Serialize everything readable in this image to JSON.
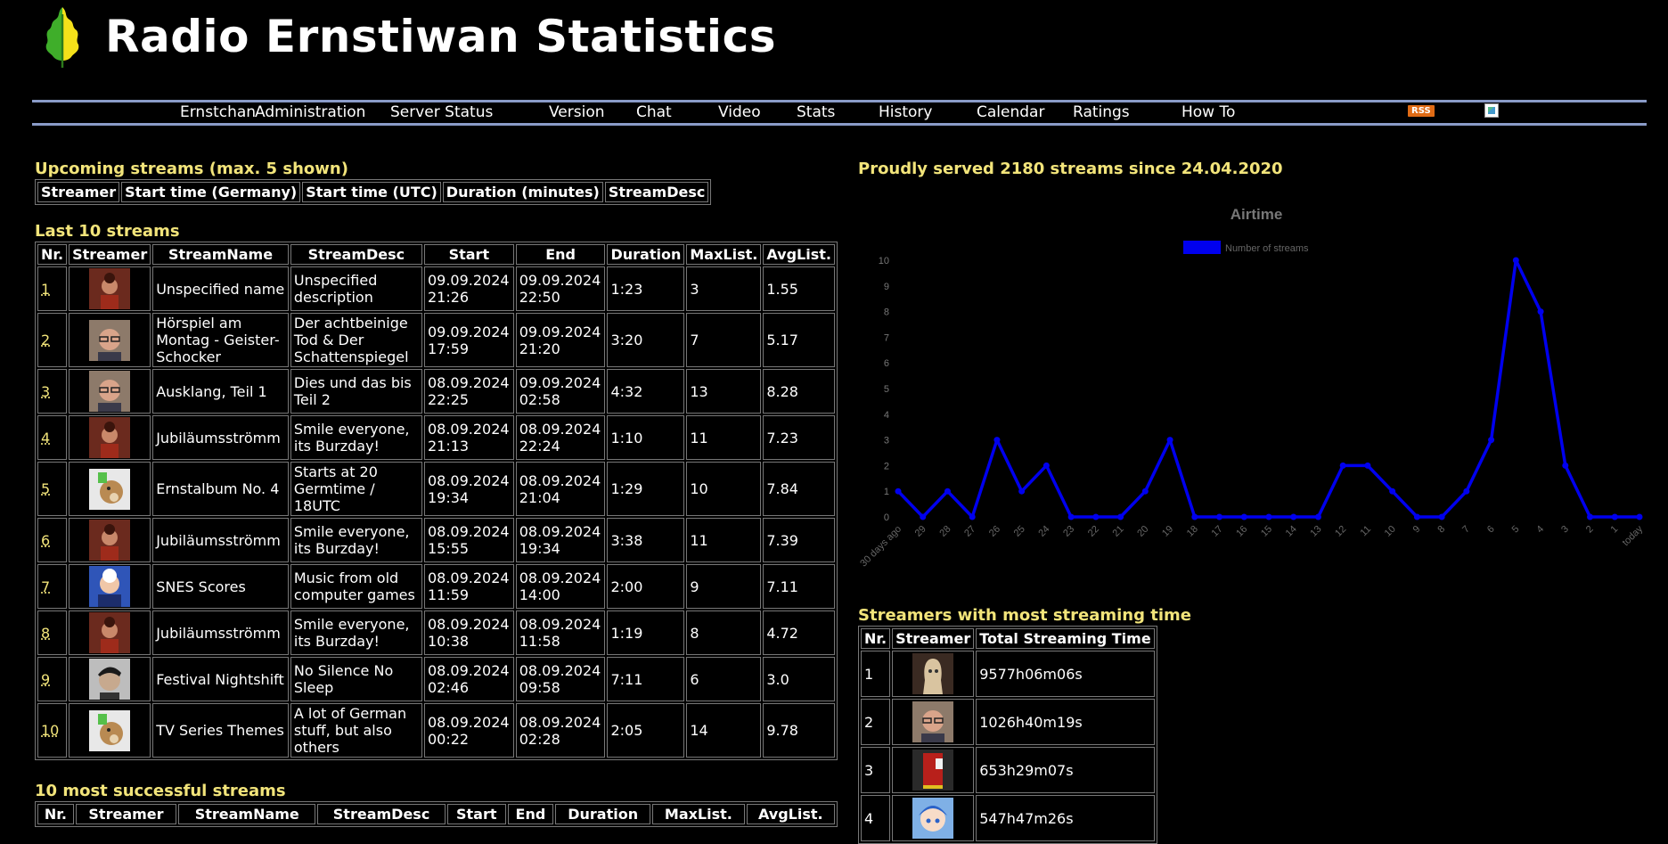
{
  "site": {
    "title": "Radio Ernstiwan Statistics"
  },
  "nav": {
    "items": [
      "Ernstchan",
      "Administration",
      "Server Status",
      "Version",
      "Chat",
      "Video",
      "Stats",
      "History",
      "Calendar",
      "Ratings",
      "How To"
    ],
    "rss_label": "RSS"
  },
  "upcoming": {
    "title": "Upcoming streams (max. 5 shown)",
    "headers": [
      "Streamer",
      "Start time (Germany)",
      "Start time (UTC)",
      "Duration (minutes)",
      "StreamDesc"
    ]
  },
  "last10": {
    "title": "Last 10 streams",
    "headers": [
      "Nr.",
      "Streamer",
      "StreamName",
      "StreamDesc",
      "Start",
      "End",
      "Duration",
      "MaxList.",
      "AvgList."
    ],
    "rows": [
      {
        "nr": "1",
        "avatar": "red-figure",
        "name": "Unspecified name",
        "desc": "Unspecified description",
        "start": "09.09.2024 21:26",
        "end": "09.09.2024 22:50",
        "duration": "1:23",
        "max": "3",
        "avg": "1.55"
      },
      {
        "nr": "2",
        "avatar": "glasses-man",
        "name": "Hörspiel am Montag - Geister-Schocker",
        "desc": "Der achtbeinige Tod & Der Schattenspiegel",
        "start": "09.09.2024 17:59",
        "end": "09.09.2024 21:20",
        "duration": "3:20",
        "max": "7",
        "avg": "5.17"
      },
      {
        "nr": "3",
        "avatar": "glasses-man",
        "name": "Ausklang, Teil 1",
        "desc": "Dies und das bis Teil 2",
        "start": "08.09.2024 22:25",
        "end": "09.09.2024 02:58",
        "duration": "4:32",
        "max": "13",
        "avg": "8.28"
      },
      {
        "nr": "4",
        "avatar": "red-figure",
        "name": "Jubiläumsströmm",
        "desc": "Smile everyone, its Burzday!",
        "start": "08.09.2024 21:13",
        "end": "08.09.2024 22:24",
        "duration": "1:10",
        "max": "11",
        "avg": "7.23"
      },
      {
        "nr": "5",
        "avatar": "bear",
        "name": "Ernstalbum No. 4",
        "desc": "Starts at 20 Germtime / 18UTC",
        "start": "08.09.2024 19:34",
        "end": "08.09.2024 21:04",
        "duration": "1:29",
        "max": "10",
        "avg": "7.84"
      },
      {
        "nr": "6",
        "avatar": "red-figure",
        "name": "Jubiläumsströmm",
        "desc": "Smile everyone, its Burzday!",
        "start": "08.09.2024 15:55",
        "end": "08.09.2024 19:34",
        "duration": "3:38",
        "max": "11",
        "avg": "7.39"
      },
      {
        "nr": "7",
        "avatar": "old-man",
        "name": "SNES Scores",
        "desc": "Music from old computer games",
        "start": "08.09.2024 11:59",
        "end": "08.09.2024 14:00",
        "duration": "2:00",
        "max": "9",
        "avg": "7.11"
      },
      {
        "nr": "8",
        "avatar": "red-figure",
        "name": "Jubiläumsströmm",
        "desc": "Smile everyone, its Burzday!",
        "start": "08.09.2024 10:38",
        "end": "08.09.2024 11:58",
        "duration": "1:19",
        "max": "8",
        "avg": "4.72"
      },
      {
        "nr": "9",
        "avatar": "elvis",
        "name": "Festival Nightshift",
        "desc": "No Silence No Sleep",
        "start": "08.09.2024 02:46",
        "end": "08.09.2024 09:58",
        "duration": "7:11",
        "max": "6",
        "avg": "3.0"
      },
      {
        "nr": "10",
        "avatar": "bear",
        "name": "TV Series Themes",
        "desc": "A lot of German stuff, but also others",
        "start": "08.09.2024 00:22",
        "end": "08.09.2024 02:28",
        "duration": "2:05",
        "max": "14",
        "avg": "9.78"
      }
    ]
  },
  "successful": {
    "title": "10 most successful streams",
    "headers": [
      "Nr.",
      "Streamer",
      "StreamName",
      "StreamDesc",
      "Start",
      "End",
      "Duration",
      "MaxList.",
      "AvgList."
    ]
  },
  "served": {
    "text": "Proudly served 2180 streams since 24.04.2020"
  },
  "top_streamers": {
    "title": "Streamers with most streaming time",
    "headers": [
      "Nr.",
      "Streamer",
      "Total Streaming Time"
    ],
    "rows": [
      {
        "nr": "1",
        "avatar": "ghost",
        "time": "9577h06m06s"
      },
      {
        "nr": "2",
        "avatar": "glasses-man",
        "time": "1026h40m19s"
      },
      {
        "nr": "3",
        "avatar": "red-box",
        "time": "653h29m07s"
      },
      {
        "nr": "4",
        "avatar": "anime",
        "time": "547h47m26s"
      }
    ]
  },
  "chart_data": {
    "type": "line",
    "title": "Airtime",
    "series": [
      {
        "name": "Number of streams",
        "color": "#0000ee",
        "values": [
          1,
          0,
          1,
          0,
          3,
          1,
          2,
          0,
          0,
          0,
          1,
          3,
          0,
          0,
          0,
          0,
          0,
          0,
          2,
          2,
          1,
          0,
          0,
          1,
          3,
          10,
          8,
          2,
          0,
          0,
          0
        ]
      }
    ],
    "categories": [
      "30 days ago",
      "29",
      "28",
      "27",
      "26",
      "25",
      "24",
      "23",
      "22",
      "21",
      "20",
      "19",
      "18",
      "17",
      "16",
      "15",
      "14",
      "13",
      "12",
      "11",
      "10",
      "9",
      "8",
      "7",
      "6",
      "5",
      "4",
      "3",
      "2",
      "1",
      "today"
    ],
    "ylim": [
      0,
      10
    ],
    "yticks": [
      "0",
      "1",
      "2",
      "3",
      "4",
      "5",
      "6",
      "7",
      "8",
      "9",
      "10"
    ],
    "legend": "top",
    "grid": false
  }
}
